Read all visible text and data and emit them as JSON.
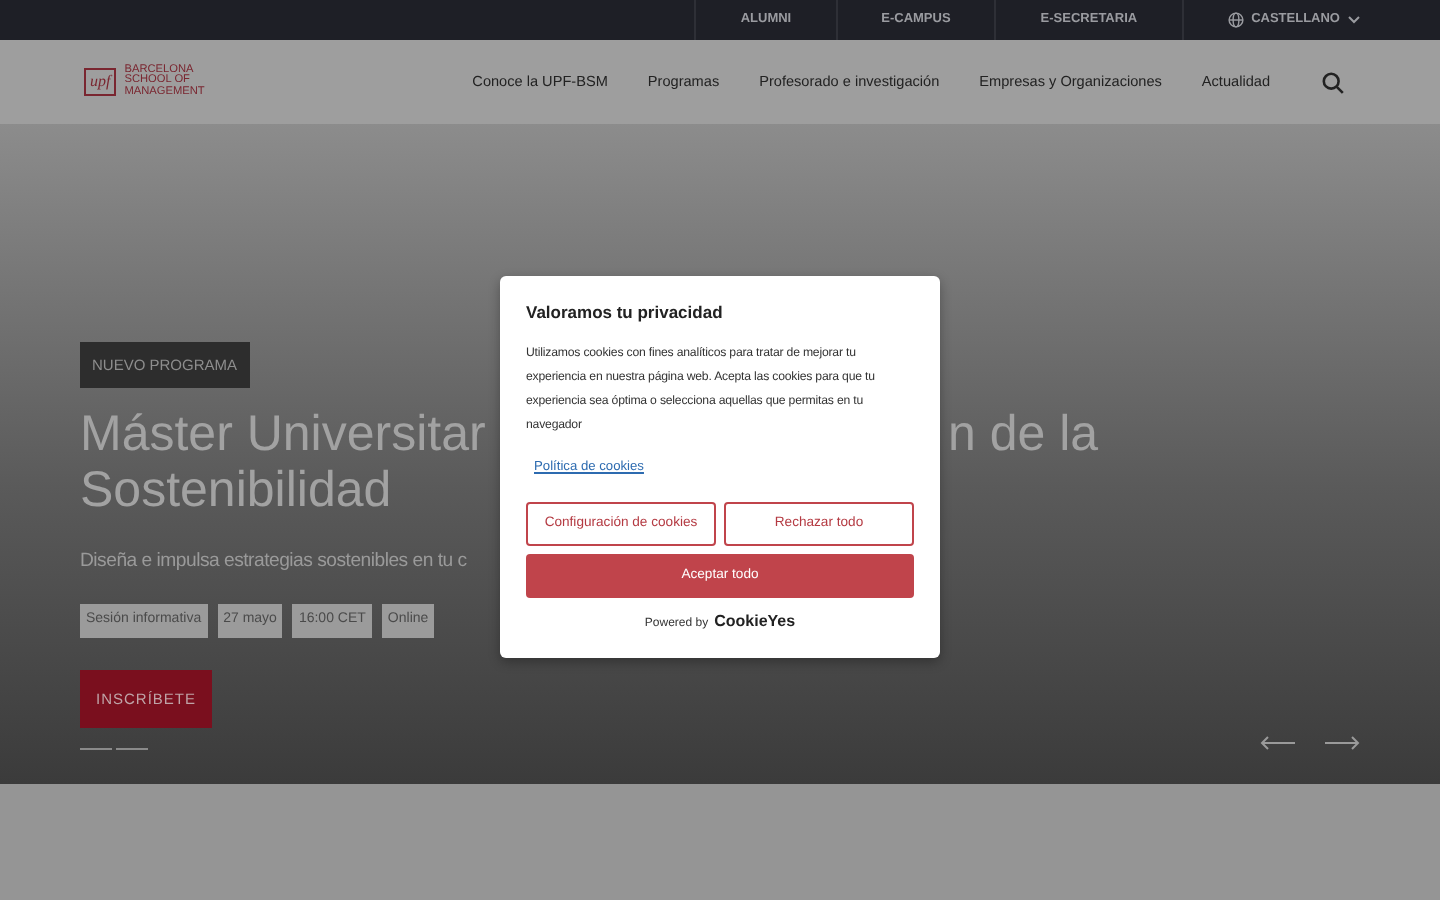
{
  "top_bar": {
    "links": [
      "ALUMNI",
      "E-CAMPUS",
      "E-SECRETARIA"
    ],
    "language": "CASTELLANO"
  },
  "header": {
    "logo_mark": "upf",
    "logo_text": [
      "BARCELONA",
      "SCHOOL OF",
      "MANAGEMENT"
    ],
    "nav": [
      "Conoce la UPF-BSM",
      "Programas",
      "Profesorado e investigación",
      "Empresas y Organizaciones",
      "Actualidad"
    ]
  },
  "hero": {
    "tag": "NUEVO PROGRAMA",
    "title_line_1": [
      "Máster Universitar",
      "n de la"
    ],
    "title_line_2": "Sostenibilidad",
    "subtitle": "Diseña e impulsa estrategias sostenibles en tu c",
    "chips": [
      "Sesión informativa",
      "27 mayo",
      "16:00 CET",
      "Online"
    ],
    "cta": "INSCRÍBETE"
  },
  "cookie_dialog": {
    "title": "Valoramos tu privacidad",
    "text": "Utilizamos cookies con fines analíticos para tratar de mejorar tu experiencia en nuestra página web. Acepta las cookies para que tu experiencia sea óptima o selecciona aquellas que permitas en tu navegador",
    "policy_link": "Política de cookies",
    "buttons": [
      "Configuración de cookies",
      "Rechazar todo"
    ],
    "accept": "Aceptar todo",
    "powered_by": "Powered by",
    "brand": "CookieYes"
  }
}
